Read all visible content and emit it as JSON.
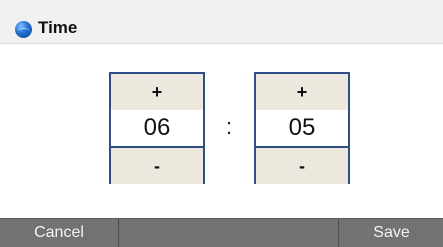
{
  "header": {
    "title": "Time",
    "icon": "globe-icon"
  },
  "time": {
    "hours": {
      "increment": "+",
      "value": "06",
      "decrement": "-"
    },
    "separator": ":",
    "minutes": {
      "increment": "+",
      "value": "05",
      "decrement": "-"
    }
  },
  "footer": {
    "cancel_label": "Cancel",
    "save_label": "Save"
  },
  "colors": {
    "accent_border": "#2e4f86",
    "stepper_bg": "#ece8dd",
    "footer_bg": "#737373"
  }
}
